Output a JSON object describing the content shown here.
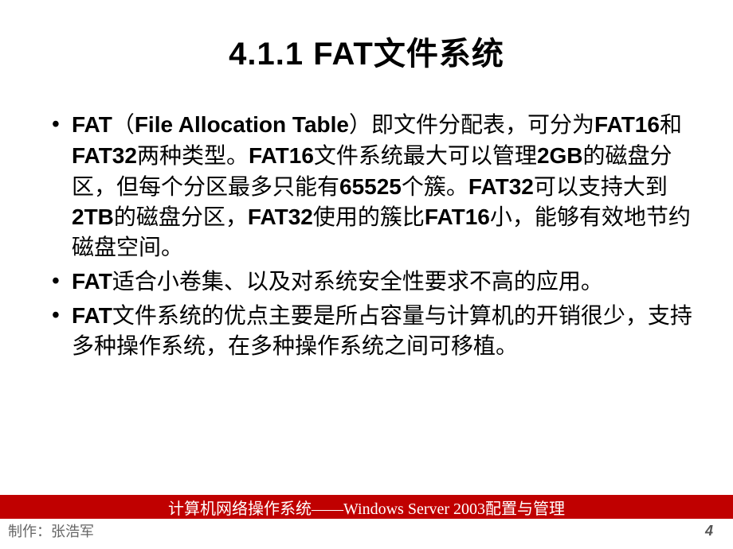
{
  "title": "4.1.1  FAT文件系统",
  "bullets": [
    {
      "parts": [
        {
          "text": "FAT",
          "bold": true
        },
        {
          "text": "（",
          "bold": false
        },
        {
          "text": "File Allocation Table",
          "bold": true
        },
        {
          "text": "）即文件分配表，可分为",
          "bold": false
        },
        {
          "text": "FAT16",
          "bold": true
        },
        {
          "text": "和",
          "bold": false
        },
        {
          "text": "FAT32",
          "bold": true
        },
        {
          "text": "两种类型。",
          "bold": false
        },
        {
          "text": "FAT16",
          "bold": true
        },
        {
          "text": "文件系统最大可以管理",
          "bold": false
        },
        {
          "text": "2GB",
          "bold": true
        },
        {
          "text": "的磁盘分区，但每个分区最多只能有",
          "bold": false
        },
        {
          "text": "65525",
          "bold": true
        },
        {
          "text": "个簇。",
          "bold": false
        },
        {
          "text": "FAT32",
          "bold": true
        },
        {
          "text": "可以支持大到",
          "bold": false
        },
        {
          "text": "2TB",
          "bold": true
        },
        {
          "text": "的磁盘分区，",
          "bold": false
        },
        {
          "text": "FAT32",
          "bold": true
        },
        {
          "text": "使用的簇比",
          "bold": false
        },
        {
          "text": "FAT16",
          "bold": true
        },
        {
          "text": "小，能够有效地节约磁盘空间。",
          "bold": false
        }
      ]
    },
    {
      "parts": [
        {
          "text": "FAT",
          "bold": true
        },
        {
          "text": "适合小卷集、以及对系统安全性要求不高的应用。",
          "bold": false
        }
      ]
    },
    {
      "parts": [
        {
          "text": "FAT",
          "bold": true
        },
        {
          "text": "文件系统的优点主要是所占容量与计算机的开销很少，支持多种操作系统，在多种操作系统之间可移植。",
          "bold": false
        }
      ]
    }
  ],
  "footer": "计算机网络操作系统——Windows Server 2003配置与管理",
  "author": "制作：张浩军",
  "page": "4"
}
